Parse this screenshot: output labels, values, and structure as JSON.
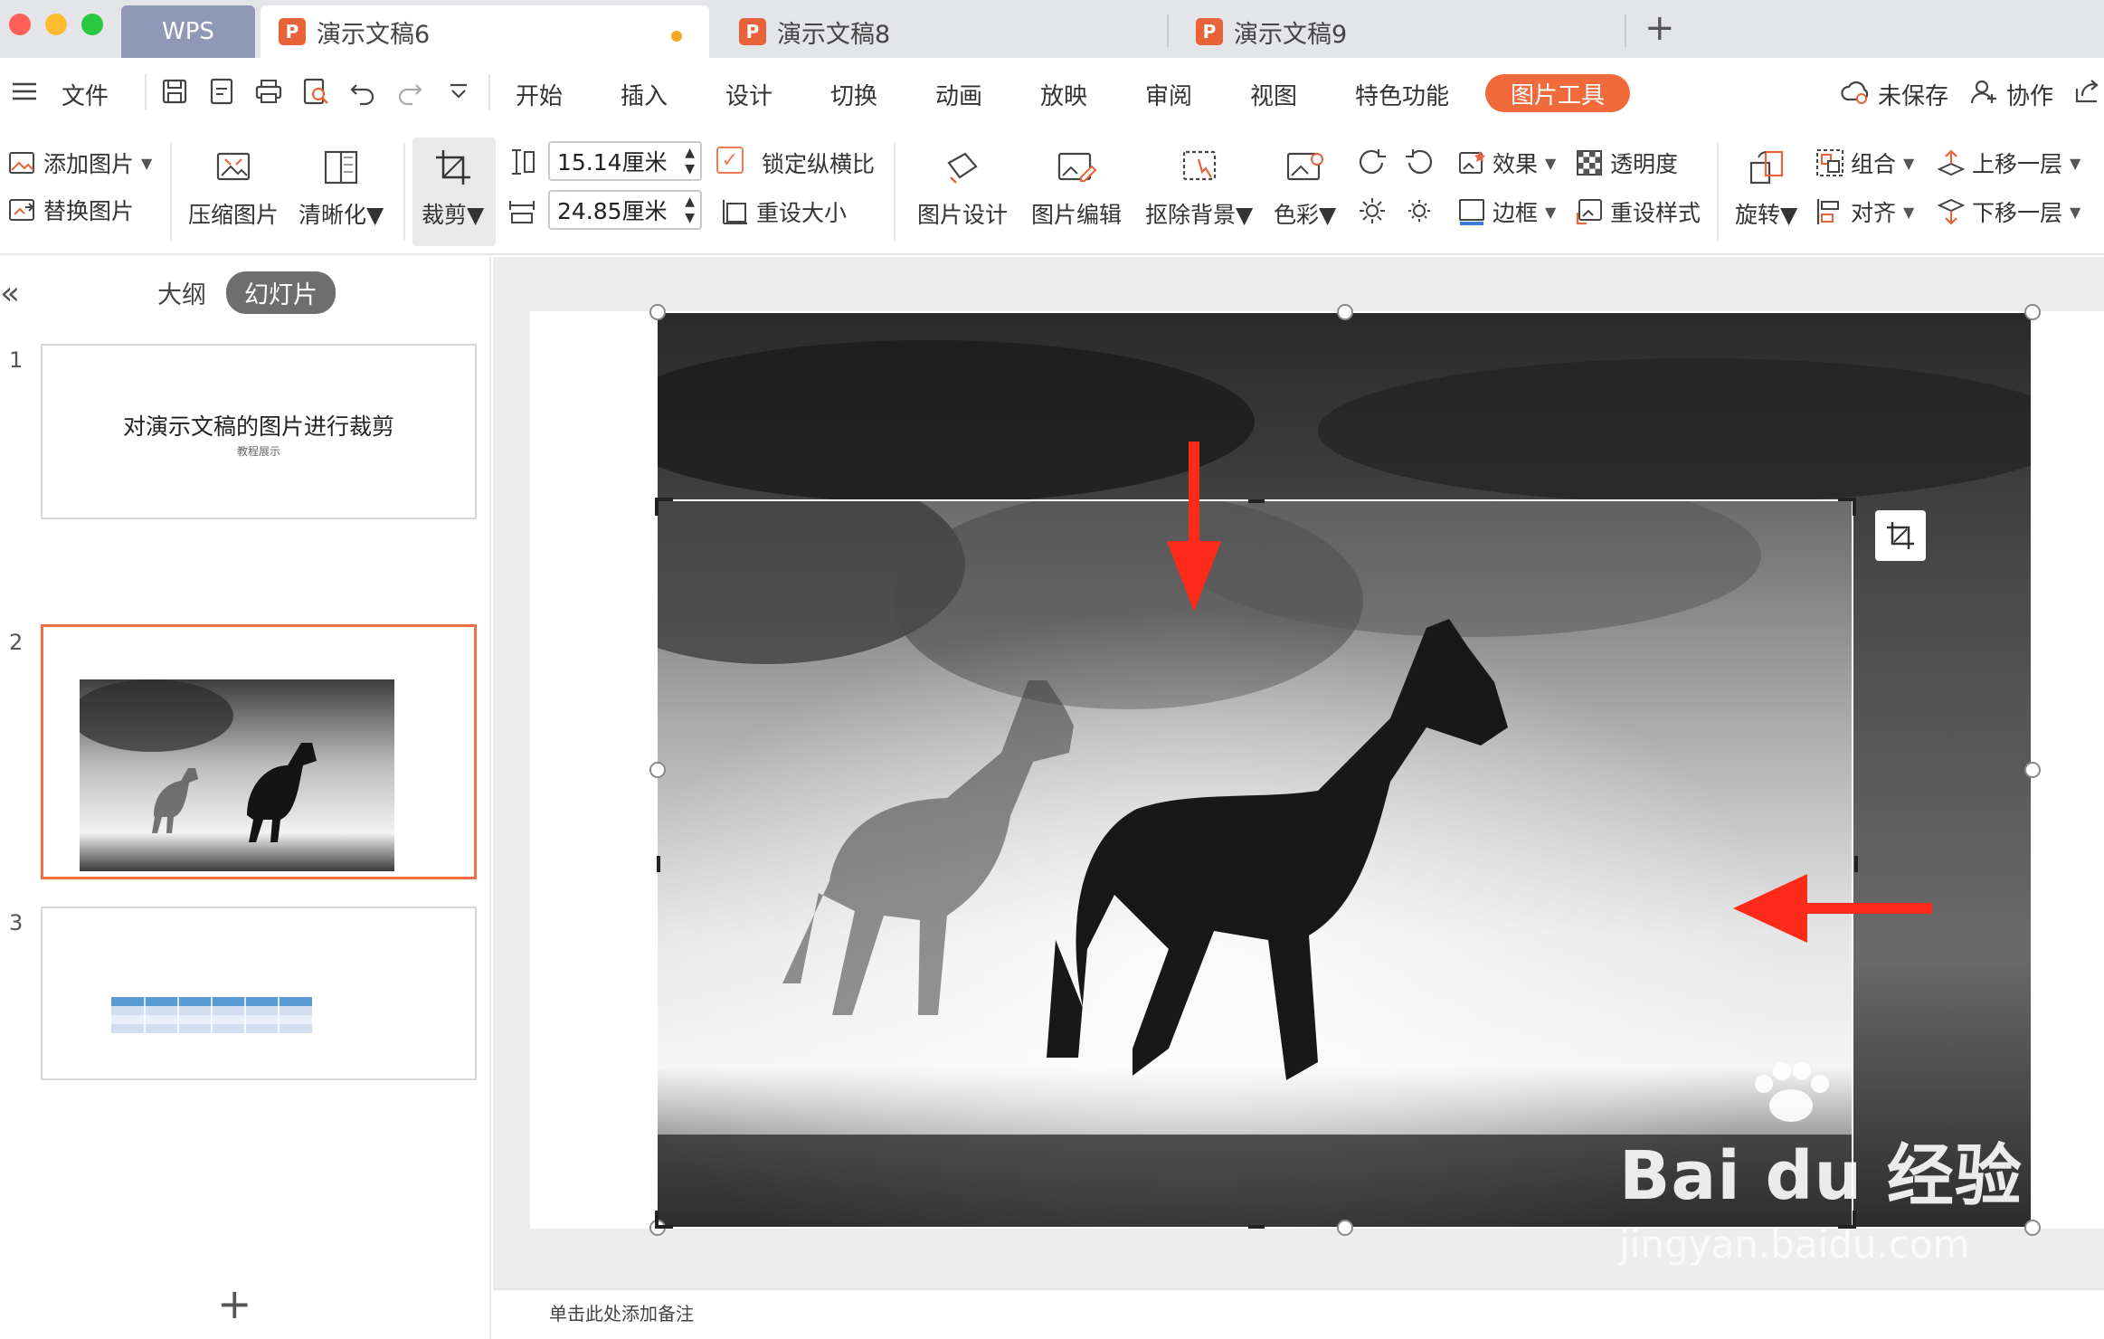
{
  "tabs": {
    "app": "WPS",
    "docs": [
      "演示文稿6",
      "演示文稿8",
      "演示文稿9"
    ],
    "new_tab": "+"
  },
  "menu": {
    "file": "文件",
    "items": [
      "开始",
      "插入",
      "设计",
      "切换",
      "动画",
      "放映",
      "审阅",
      "视图",
      "特色功能"
    ],
    "picture_tools": "图片工具",
    "unsaved": "未保存",
    "collaborate": "协作"
  },
  "ribbon": {
    "add_picture": "添加图片",
    "replace_picture": "替换图片",
    "compress": "压缩图片",
    "sharpen": "清晰化",
    "crop": "裁剪",
    "height_value": "15.14厘米",
    "width_value": "24.85厘米",
    "lock_ratio": "锁定纵横比",
    "reset_size": "重设大小",
    "picture_design": "图片设计",
    "picture_edit": "图片编辑",
    "remove_bg": "抠除背景",
    "color": "色彩",
    "effects": "效果",
    "transparency": "透明度",
    "border": "边框",
    "reset_style": "重设样式",
    "rotate": "旋转",
    "group": "组合",
    "align": "对齐",
    "bring_forward": "上移一层",
    "send_backward": "下移一层"
  },
  "left_panel": {
    "collapse": "«",
    "tab_outline": "大纲",
    "tab_slides": "幻灯片",
    "slides": [
      {
        "num": "1",
        "title": "对演示文稿的图片进行裁剪",
        "subtitle": "教程展示"
      },
      {
        "num": "2"
      },
      {
        "num": "3"
      }
    ],
    "add": "+"
  },
  "notes": {
    "placeholder": "单击此处添加备注"
  },
  "watermark": {
    "main": "Bai du 经验",
    "sub": "jingyan.baidu.com"
  }
}
